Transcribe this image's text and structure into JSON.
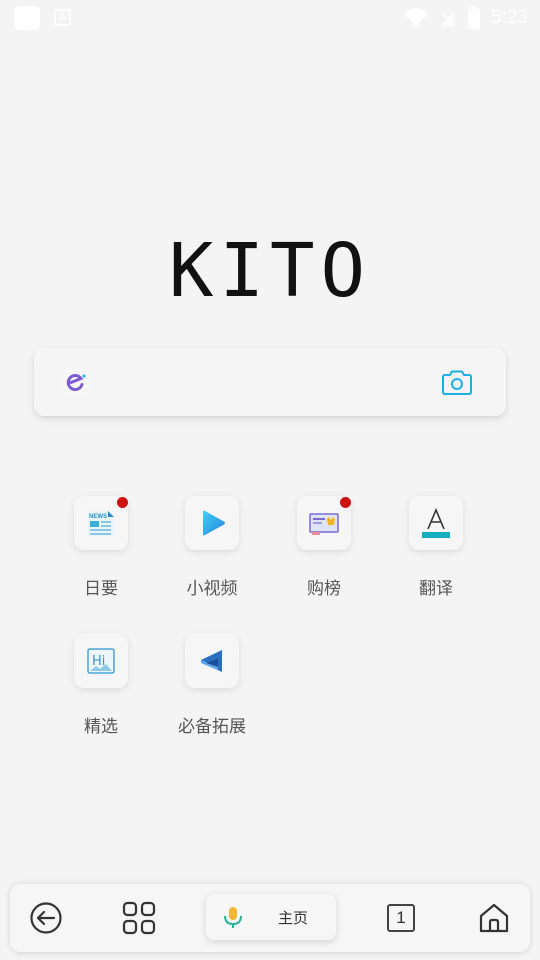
{
  "status_bar": {
    "time": "5:23",
    "notification_icon": "a-icon"
  },
  "logo": "KITO",
  "search": {
    "placeholder": "",
    "engine_icon": "search-engine-icon",
    "camera_icon": "camera-icon"
  },
  "shortcuts": [
    {
      "label": "日要",
      "icon": "news-icon",
      "badge": true
    },
    {
      "label": "小视频",
      "icon": "play-icon",
      "badge": false
    },
    {
      "label": "购榜",
      "icon": "shopping-rank-icon",
      "badge": true
    },
    {
      "label": "翻译",
      "icon": "translate-icon",
      "badge": false
    },
    {
      "label": "精选",
      "icon": "hi-icon",
      "badge": false
    },
    {
      "label": "必备拓展",
      "icon": "extension-icon",
      "badge": false
    }
  ],
  "bottom_bar": {
    "home_label": "主页",
    "tab_count": "1"
  },
  "colors": {
    "background": "#f4f4f4",
    "accent_cyan": "#1ab0e0",
    "badge_red": "#cc1111"
  }
}
